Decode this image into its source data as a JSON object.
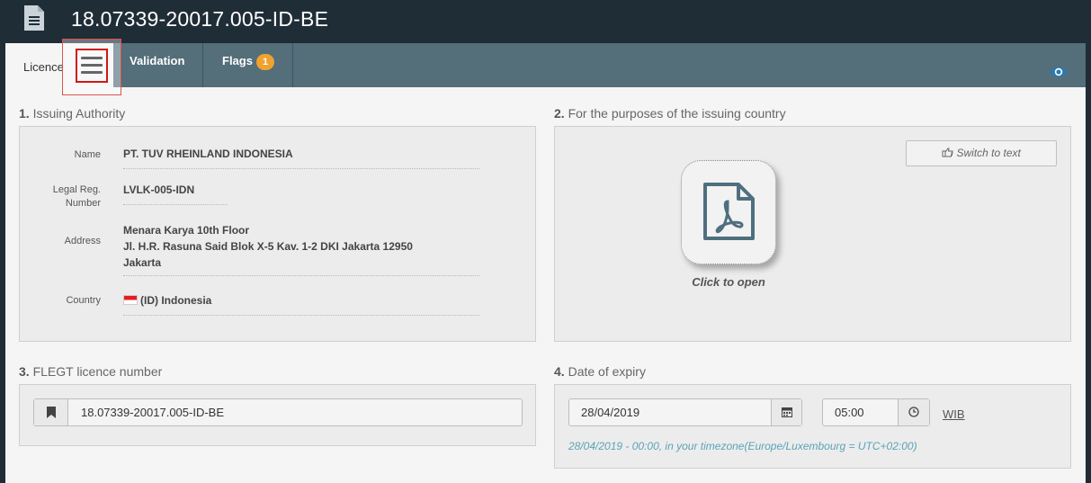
{
  "header": {
    "title": "18.07339-20017.005-ID-BE",
    "icon": "document-icon"
  },
  "tabs": {
    "licence": "Licence",
    "validation": "Validation",
    "flags": "Flags",
    "flags_count": "1"
  },
  "section1": {
    "number": "1.",
    "title": "Issuing Authority",
    "name_label": "Name",
    "name_value": "PT. TUV RHEINLAND INDONESIA",
    "legal_label_line1": "Legal Reg.",
    "legal_label_line2": "Number",
    "legal_value": "LVLK-005-IDN",
    "address_label": "Address",
    "address_line1": "Menara Karya 10th Floor",
    "address_line2": "Jl. H.R. Rasuna Said Blok X-5 Kav. 1-2 DKI Jakarta 12950",
    "address_line3": "Jakarta",
    "country_label": "Country",
    "country_value": "(ID) Indonesia"
  },
  "section2": {
    "number": "2.",
    "title": "For the purposes of the issuing country",
    "switch_label": "Switch to text",
    "click_to_open": "Click to open"
  },
  "section3": {
    "number": "3.",
    "title": "FLEGT licence number",
    "value": "18.07339-20017.005-ID-BE"
  },
  "section4": {
    "number": "4.",
    "title": "Date of expiry",
    "date_value": "28/04/2019",
    "time_value": "05:00",
    "timezone": "WIB",
    "note": "28/04/2019 - 00:00, in your timezone(Europe/Luxembourg = UTC+02:00)"
  },
  "colors": {
    "header_bg": "#1f2d37",
    "tabbar_bg": "#546e7a",
    "badge": "#f0a22e",
    "accent": "#2a7ab0",
    "note": "#5ba3b8"
  }
}
